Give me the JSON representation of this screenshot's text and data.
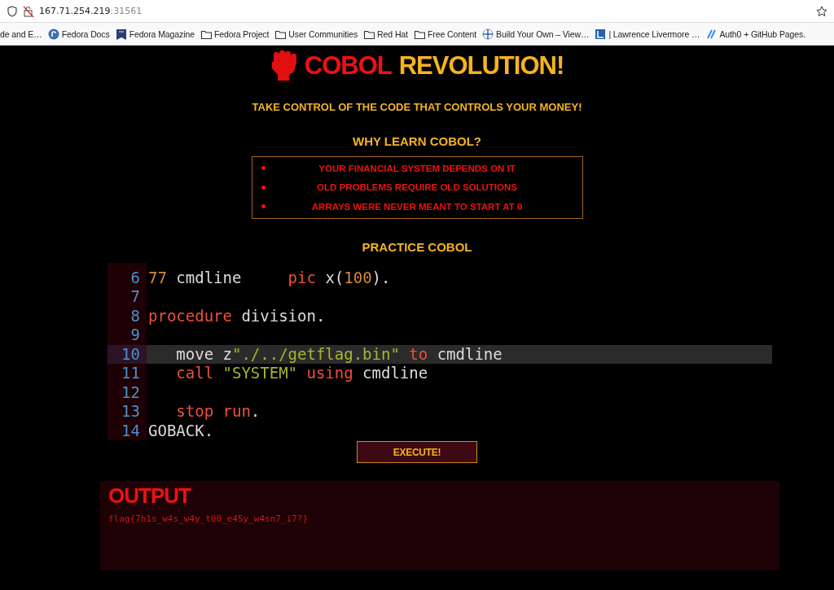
{
  "browser": {
    "url_host": "167.71.254.219",
    "url_port": ":31561",
    "bookmarks": [
      {
        "label": "de and E…",
        "kind": "plain"
      },
      {
        "label": "Fedora Docs",
        "kind": "circle"
      },
      {
        "label": "Fedora Magazine",
        "kind": "ribbon"
      },
      {
        "label": "Fedora Project",
        "kind": "folder"
      },
      {
        "label": "User Communities",
        "kind": "folder"
      },
      {
        "label": "Red Hat",
        "kind": "folder"
      },
      {
        "label": "Free Content",
        "kind": "folder"
      },
      {
        "label": "Build Your Own – View…",
        "kind": "globe"
      },
      {
        "label": "| Lawrence Livermore …",
        "kind": "square"
      },
      {
        "label": "Auth0 + GitHub Pages.",
        "kind": "slash"
      }
    ]
  },
  "header": {
    "title_parts": [
      {
        "text": "COBOL",
        "color": "#ee1111"
      },
      {
        "text": "REVOLUTION!",
        "color": "#f5b320"
      }
    ],
    "tagline": "TAKE CONTROL OF THE CODE THAT CONTROLS YOUR MONEY!"
  },
  "why": {
    "heading": "WHY LEARN COBOL?",
    "items": [
      "YOUR FINANCIAL SYSTEM DEPENDS ON IT",
      "OLD PROBLEMS REQUIRE OLD SOLUTIONS",
      "ARRAYS WERE NEVER MEANT TO START AT 0"
    ]
  },
  "practice": {
    "heading": "PRACTICE COBOL",
    "lines": [
      {
        "number": "6",
        "active": false,
        "tokens": [
          {
            "kind": "number",
            "text": "77"
          },
          {
            "kind": "plain",
            "text": " cmdline     "
          },
          {
            "kind": "keyword",
            "text": "pic"
          },
          {
            "kind": "plain",
            "text": " x("
          },
          {
            "kind": "number",
            "text": "100"
          },
          {
            "kind": "plain",
            "text": ")."
          }
        ]
      },
      {
        "number": "7",
        "active": false
      },
      {
        "number": "8",
        "active": false,
        "tokens": [
          {
            "kind": "keyword",
            "text": "procedure"
          },
          {
            "kind": "plain",
            "text": " division."
          }
        ]
      },
      {
        "number": "9",
        "active": false
      },
      {
        "number": "10",
        "active": true,
        "tokens": [
          {
            "kind": "plain",
            "text": "   move z"
          },
          {
            "kind": "string",
            "text": "\"./../getflag.bin\""
          },
          {
            "kind": "keyword",
            "text": " to"
          },
          {
            "kind": "plain",
            "text": " cmdline"
          }
        ]
      },
      {
        "number": "11",
        "active": false,
        "tokens": [
          {
            "kind": "keyword",
            "text": "   call "
          },
          {
            "kind": "string",
            "text": "\"SYSTEM\""
          },
          {
            "kind": "keyword",
            "text": " using"
          },
          {
            "kind": "plain",
            "text": " cmdline"
          }
        ]
      },
      {
        "number": "12",
        "active": false
      },
      {
        "number": "13",
        "active": false,
        "tokens": [
          {
            "kind": "keyword",
            "text": "   stop run"
          },
          {
            "kind": "plain",
            "text": "."
          }
        ]
      },
      {
        "number": "14",
        "active": false,
        "tokens": [
          {
            "kind": "plain",
            "text": "GOBACK."
          }
        ]
      }
    ],
    "button": "EXECUTE!"
  },
  "output": {
    "title": "OUTPUT",
    "text": "flag{7h1s_w4s_w4y_t00_e45y_w4sn7_i7?}"
  }
}
